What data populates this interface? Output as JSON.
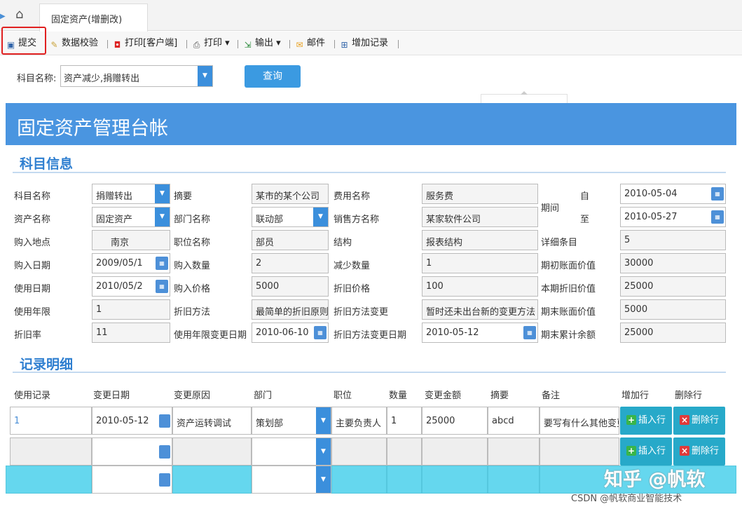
{
  "tabs": {
    "active": "固定资产(增删改)"
  },
  "toolbar": {
    "submit": "提交",
    "validate": "数据校验",
    "print_client": "打印[客户端]",
    "print": "打印",
    "export": "输出",
    "mail": "邮件",
    "add_record": "增加记录"
  },
  "query": {
    "label": "科目名称:",
    "value": "资产减少,捐赠转出",
    "button": "查询"
  },
  "header": {
    "title": "固定资产管理台帐"
  },
  "subject_info": {
    "section_title": "科目信息",
    "subject_name_label": "科目名称",
    "subject_name": "捐赠转出",
    "summary_label": "摘要",
    "summary": "某市的某个公司",
    "expense_name_label": "费用名称",
    "expense_name": "服务费",
    "period_label": "期间",
    "period_from_label": "自",
    "period_from": "2010-05-04",
    "period_to_label": "至",
    "period_to": "2010-05-27",
    "asset_name_label": "资产名称",
    "asset_name": "固定资产",
    "dept_label": "部门名称",
    "dept": "联动部",
    "seller_label": "销售方名称",
    "seller": "某家软件公司",
    "location_label": "购入地点",
    "location": "南京",
    "position_label": "职位名称",
    "position": "部员",
    "structure_label": "结构",
    "structure": "报表结构",
    "detail_count_label": "详细条目",
    "detail_count": "5",
    "purchase_date_label": "购入日期",
    "purchase_date": "2009/05/1",
    "purchase_qty_label": "购入数量",
    "purchase_qty": "2",
    "decrease_qty_label": "减少数量",
    "decrease_qty": "1",
    "begin_value_label": "期初账面价值",
    "begin_value": "30000",
    "use_date_label": "使用日期",
    "use_date": "2010/05/2",
    "purchase_price_label": "购入价格",
    "purchase_price": "5000",
    "depr_price_label": "折旧价格",
    "depr_price": "100",
    "period_depr_label": "本期折旧价值",
    "period_depr": "25000",
    "use_years_label": "使用年限",
    "use_years": "1",
    "depr_method_label": "折旧方法",
    "depr_method": "最简单的折旧原则",
    "depr_method_change_label": "折旧方法变更",
    "depr_method_change": "暂时还未出台新的变更方法",
    "end_value_label": "期末账面价值",
    "end_value": "5000",
    "depr_rate_label": "折旧率",
    "depr_rate": "11",
    "use_years_change_date_label": "使用年限变更日期",
    "use_years_change_date": "2010-06-10",
    "depr_change_date_label": "折旧方法变更日期",
    "depr_change_date": "2010-05-12",
    "end_balance_label": "期末累计余额",
    "end_balance": "25000"
  },
  "records": {
    "section_title": "记录明细",
    "columns": [
      "使用记录",
      "变更日期",
      "变更原因",
      "部门",
      "职位",
      "数量",
      "变更金额",
      "摘要",
      "备注",
      "增加行",
      "删除行"
    ],
    "rows": [
      {
        "record": "1",
        "date": "2010-05-12",
        "reason": "资产运转调试",
        "dept": "策划部",
        "position": "主要负责人",
        "qty": "1",
        "amount": "25000",
        "summary": "abcd",
        "note": "要写有什么其他变更"
      }
    ],
    "insert_label": "插入行",
    "delete_label": "删除行"
  },
  "watermark": {
    "text": "知乎 @帆软",
    "csdn": "CSDN @帆软商业智能技术"
  }
}
